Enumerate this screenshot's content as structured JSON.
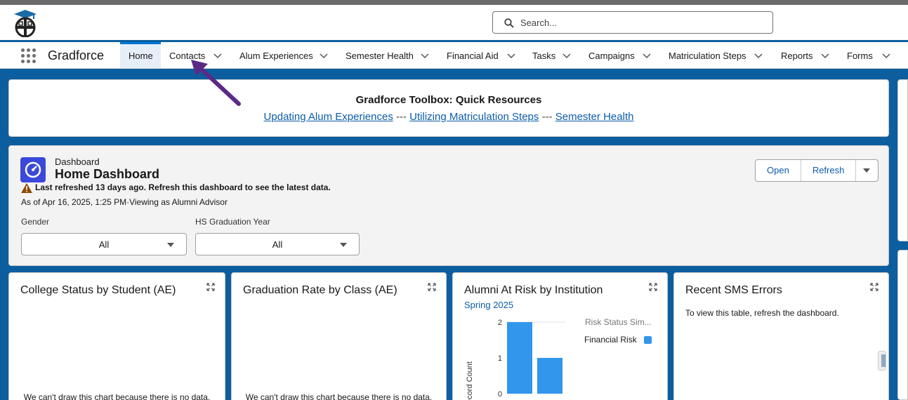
{
  "header": {
    "search_placeholder": "Search...",
    "logo_icon": "gradforce-logo-icon"
  },
  "nav": {
    "app_name": "Gradforce",
    "tabs": [
      {
        "label": "Home",
        "active": true
      },
      {
        "label": "Contacts"
      },
      {
        "label": "Alum Experiences"
      },
      {
        "label": "Semester Health"
      },
      {
        "label": "Financial Aid"
      },
      {
        "label": "Tasks"
      },
      {
        "label": "Campaigns"
      },
      {
        "label": "Matriculation Steps"
      },
      {
        "label": "Reports"
      },
      {
        "label": "Forms"
      }
    ]
  },
  "toolbox": {
    "title": "Gradforce Toolbox: Quick Resources",
    "link1": "Updating Alum Experiences",
    "link2": "Utilizing Matriculation Steps",
    "link3": "Semester Health",
    "separator": " --- "
  },
  "dashboard": {
    "subtitle": "Dashboard",
    "title": "Home Dashboard",
    "warning": "Last refreshed 13 days ago. Refresh this dashboard to see the latest data.",
    "as_of": "As of Apr 16, 2025, 1:25 PM·Viewing as Alumni Advisor",
    "open_label": "Open",
    "refresh_label": "Refresh",
    "filters": [
      {
        "label": "Gender",
        "value": "All"
      },
      {
        "label": "HS Graduation Year",
        "value": "All"
      }
    ]
  },
  "widgets": {
    "college_status": {
      "title": "College Status by Student (AE)",
      "message": "We can't draw this chart because there is no data."
    },
    "graduation_rate": {
      "title": "Graduation Rate by Class (AE)",
      "message": "We can't draw this chart because there is no data."
    },
    "alumni_risk": {
      "title": "Alumni At Risk by Institution",
      "subtitle": "Spring 2025"
    },
    "sms_errors": {
      "title": "Recent SMS Errors",
      "message": "To view this table, refresh the dashboard."
    }
  },
  "chart_data": {
    "type": "bar",
    "title": "Alumni At Risk by Institution",
    "subtitle": "Spring 2025",
    "ylabel": "Record Count",
    "legend_title": "Risk Status Sim...",
    "legend_position": "right",
    "yticks": [
      0,
      1,
      2
    ],
    "ylim": [
      0,
      2
    ],
    "series": [
      {
        "name": "Financial Risk",
        "values": [
          2,
          1
        ],
        "color": "#3296ed"
      }
    ]
  },
  "colors": {
    "brand_blue": "#0d5e9e",
    "link": "#0b5cab",
    "annotation_arrow": "#5b2a86"
  }
}
